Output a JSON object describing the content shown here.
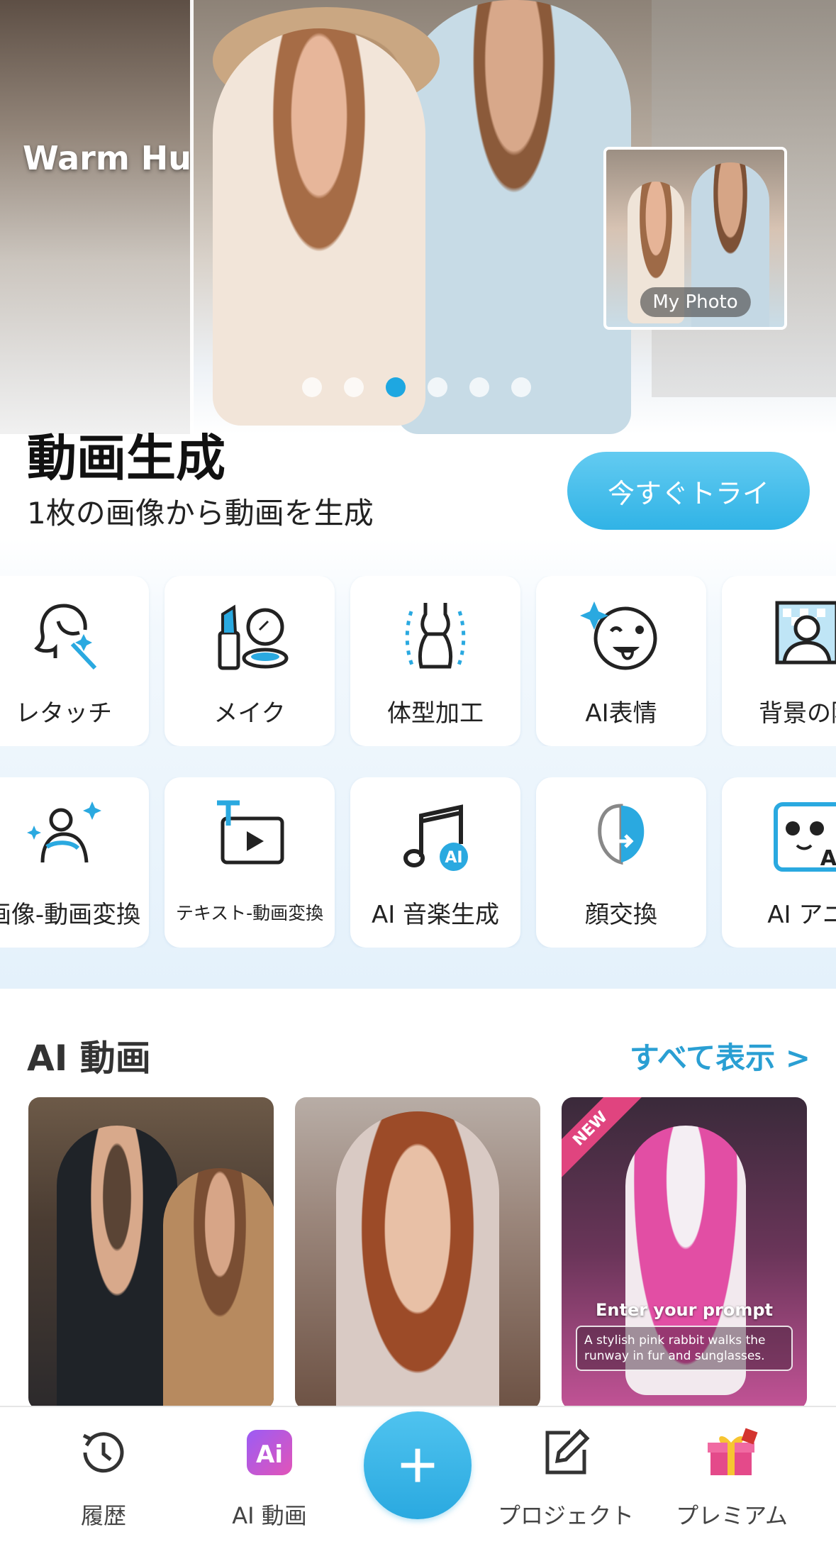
{
  "hero": {
    "style_label": "Warm Hu",
    "thumb_label": "My Photo",
    "slides_total": 6,
    "active_slide": 3
  },
  "promo": {
    "title": "動画生成",
    "subtitle": "1枚の画像から動画を生成",
    "cta": "今すぐトライ"
  },
  "tools": {
    "row1": [
      {
        "label": "レタッチ",
        "icon": "retouch-icon"
      },
      {
        "label": "メイク",
        "icon": "makeup-icon"
      },
      {
        "label": "体型加工",
        "icon": "body-shape-icon"
      },
      {
        "label": "AI表情",
        "icon": "ai-expression-icon"
      },
      {
        "label": "背景の除",
        "icon": "background-remove-icon"
      }
    ],
    "row2": [
      {
        "label": "画像-動画変換",
        "icon": "image-to-video-icon"
      },
      {
        "label": "テキスト-動画変換",
        "icon": "text-to-video-icon"
      },
      {
        "label": "AI 音楽生成",
        "icon": "ai-music-icon"
      },
      {
        "label": "顔交換",
        "icon": "face-swap-icon"
      },
      {
        "label": "AI アニ",
        "icon": "ai-anime-icon"
      }
    ]
  },
  "ai_video": {
    "title": "AI 動画",
    "see_all": "すべて表示 >",
    "cards": [
      {
        "badge": "",
        "prompt_title": "",
        "prompt_text": ""
      },
      {
        "badge": "",
        "prompt_title": "",
        "prompt_text": ""
      },
      {
        "badge": "NEW",
        "prompt_title": "Enter your prompt",
        "prompt_text": "A stylish pink rabbit walks the runway in fur and sunglasses."
      }
    ]
  },
  "tabbar": {
    "history": "履歴",
    "ai_video": "AI 動画",
    "project": "プロジェクト",
    "premium": "プレミアム",
    "add_icon": "plus-icon"
  },
  "colors": {
    "accent": "#2aa9e0",
    "link": "#2a9fd3",
    "new_badge": "#e0447f"
  }
}
